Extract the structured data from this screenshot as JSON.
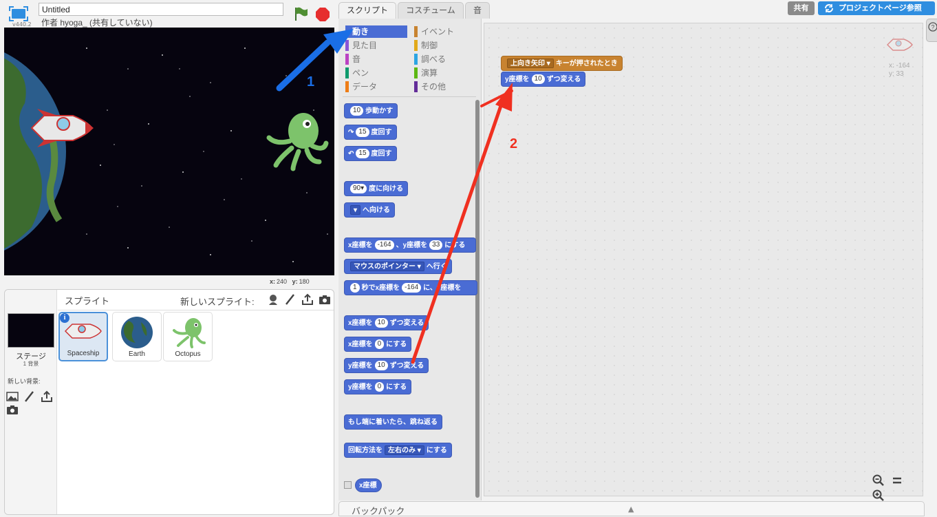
{
  "header": {
    "version": "v440.2",
    "title_value": "Untitled",
    "author": "作者 hyoga_ (共有していない)"
  },
  "stage": {
    "coords_x_label": "x:",
    "coords_x": "240",
    "coords_y_label": "y:",
    "coords_y": "180"
  },
  "sprite_panel": {
    "sprites_title": "スプライト",
    "new_sprite_label": "新しいスプライト:",
    "stage_label": "ステージ",
    "backdrop_count": "1 背景",
    "new_backdrop_label": "新しい背景:",
    "sprites": [
      {
        "name": "Spaceship",
        "selected": true
      },
      {
        "name": "Earth",
        "selected": false
      },
      {
        "name": "Octopus",
        "selected": false
      }
    ],
    "info_badge": "i"
  },
  "tabs": {
    "scripts": "スクリプト",
    "costumes": "コスチューム",
    "sounds": "音"
  },
  "categories": [
    {
      "label": "動き",
      "color": "#4a6cd4",
      "active": true
    },
    {
      "label": "イベント",
      "color": "#c88330",
      "active": false
    },
    {
      "label": "見た目",
      "color": "#8a55d7",
      "active": false
    },
    {
      "label": "制御",
      "color": "#e1a91a",
      "active": false
    },
    {
      "label": "音",
      "color": "#bb42c3",
      "active": false
    },
    {
      "label": "調べる",
      "color": "#2ca5e2",
      "active": false
    },
    {
      "label": "ペン",
      "color": "#0e9a6c",
      "active": false
    },
    {
      "label": "演算",
      "color": "#5cb712",
      "active": false
    },
    {
      "label": "データ",
      "color": "#ee7d16",
      "active": false
    },
    {
      "label": "その他",
      "color": "#632d99",
      "active": false
    }
  ],
  "palette_blocks": {
    "move": {
      "value": "10",
      "text": "歩動かす"
    },
    "turn_right": {
      "value": "15",
      "text": "度回す"
    },
    "turn_left": {
      "value": "15",
      "text": "度回す"
    },
    "point_direction": {
      "value": "90▾",
      "text": "度に向ける"
    },
    "point_towards": {
      "drop": "▾",
      "text": "へ向ける"
    },
    "goto_xy": {
      "prefix": "x座標を",
      "x": "-164",
      "mid": "、y座標を",
      "y": "33",
      "text": "にする"
    },
    "goto": {
      "drop": "マウスのポインター ▾",
      "text": "へ行く"
    },
    "glide": {
      "secs": "1",
      "mid": "秒でx座標を",
      "x": "-164",
      "text": "に、y座標を"
    },
    "change_x": {
      "prefix": "x座標を",
      "value": "10",
      "text": "ずつ変える"
    },
    "set_x": {
      "prefix": "x座標を",
      "value": "0",
      "text": "にする"
    },
    "change_y": {
      "prefix": "y座標を",
      "value": "10",
      "text": "ずつ変える"
    },
    "set_y": {
      "prefix": "y座標を",
      "value": "0",
      "text": "にする"
    },
    "bounce": {
      "text": "もし端に着いたら、跳ね返る"
    },
    "rotation_style": {
      "prefix": "回転方法を",
      "drop": "左右のみ ▾",
      "text": "にする"
    },
    "x_position": {
      "text": "x座標"
    }
  },
  "scripts": {
    "hat": {
      "drop": "上向き矢印 ▾",
      "text": "キーが押されたとき"
    },
    "change_y": {
      "prefix": "y座標を",
      "value": "10",
      "text": "ずつ変える"
    },
    "sprite_x": "x: -164",
    "sprite_y": "y: 33"
  },
  "top_right": {
    "share": "共有",
    "project_page": "プロジェクトページ参照"
  },
  "backpack": {
    "label": "バックパック",
    "arrow": "▲"
  },
  "annotations": {
    "one": "1",
    "two": "2",
    "arrow1_color": "#1a6ee6",
    "arrow2_color": "#f03020"
  }
}
